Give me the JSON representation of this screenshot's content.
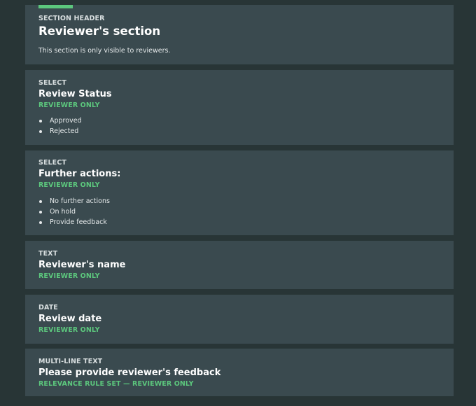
{
  "colors": {
    "page_background": "#283536",
    "card_background": "#3a4a4f",
    "accent": "#5cc77d",
    "text": "#ffffff"
  },
  "cards": [
    {
      "type": "SECTION HEADER",
      "title": "Reviewer's section",
      "description": "This section is only visible to reviewers."
    },
    {
      "type": "SELECT",
      "title": "Review Status",
      "badge": "REVIEWER ONLY",
      "options": [
        "Approved",
        "Rejected"
      ]
    },
    {
      "type": "SELECT",
      "title": "Further actions:",
      "badge": "REVIEWER ONLY",
      "options": [
        "No further actions",
        "On hold",
        "Provide feedback"
      ]
    },
    {
      "type": "TEXT",
      "title": "Reviewer's name",
      "badge": "REVIEWER ONLY"
    },
    {
      "type": "DATE",
      "title": "Review date",
      "badge": "REVIEWER ONLY"
    },
    {
      "type": "MULTI-LINE TEXT",
      "title": "Please provide reviewer's feedback",
      "badge": "RELEVANCE RULE SET — REVIEWER ONLY"
    }
  ]
}
